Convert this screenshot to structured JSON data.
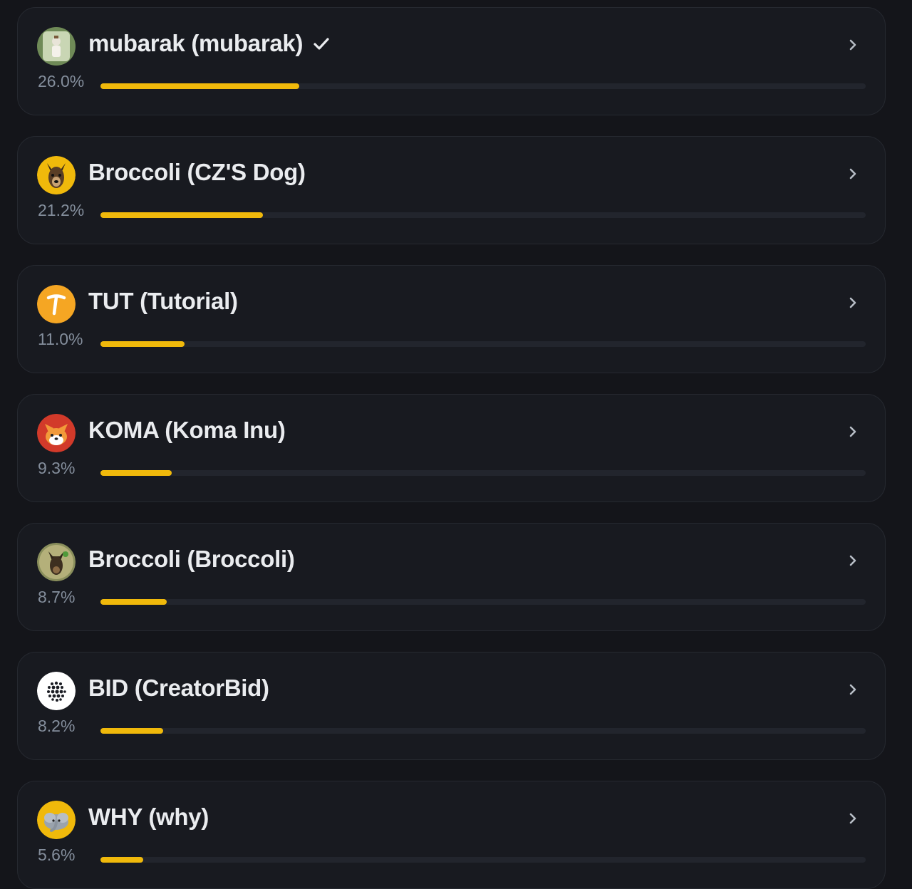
{
  "accent_color": "#f0b90b",
  "tokens": [
    {
      "name": "mubarak (mubarak)",
      "percent_label": "26.0%",
      "share": 0.26,
      "verified": true,
      "icon": "mubarak-logo-icon"
    },
    {
      "name": "Broccoli (CZ'S Dog)",
      "percent_label": "21.2%",
      "share": 0.212,
      "verified": false,
      "icon": "dog-logo-icon"
    },
    {
      "name": "TUT (Tutorial)",
      "percent_label": "11.0%",
      "share": 0.11,
      "verified": false,
      "icon": "tut-logo-icon"
    },
    {
      "name": "KOMA (Koma Inu)",
      "percent_label": "9.3%",
      "share": 0.093,
      "verified": false,
      "icon": "shiba-logo-icon"
    },
    {
      "name": "Broccoli (Broccoli)",
      "percent_label": "8.7%",
      "share": 0.087,
      "verified": false,
      "icon": "dog-photo-logo-icon"
    },
    {
      "name": "BID (CreatorBid)",
      "percent_label": "8.2%",
      "share": 0.082,
      "verified": false,
      "icon": "dots-logo-icon"
    },
    {
      "name": "WHY (why)",
      "percent_label": "5.6%",
      "share": 0.056,
      "verified": false,
      "icon": "elephant-logo-icon"
    }
  ]
}
